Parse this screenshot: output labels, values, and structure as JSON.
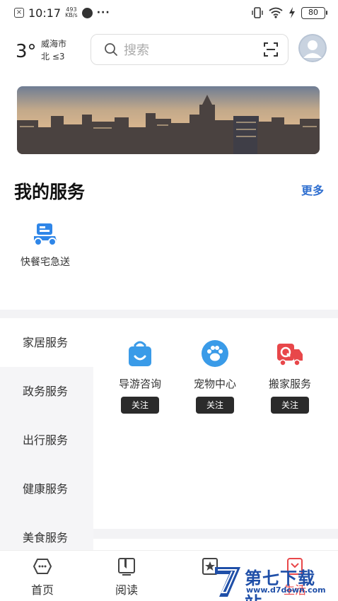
{
  "status_bar": {
    "time": "10:17",
    "net_speed_value": "493",
    "net_speed_unit": "KB/s",
    "more": "···",
    "battery": "80"
  },
  "header": {
    "temperature": "3°",
    "city": "威海市",
    "wind": "北 ≤3",
    "search_placeholder": "搜索"
  },
  "my_services": {
    "title": "我的服务",
    "more": "更多",
    "items": [
      {
        "label": "快餐宅急送",
        "icon": "scooter-icon",
        "color": "#2f86e8"
      }
    ]
  },
  "categories": {
    "items": [
      {
        "label": "家居服务",
        "active": true
      },
      {
        "label": "政务服务",
        "active": false
      },
      {
        "label": "出行服务",
        "active": false
      },
      {
        "label": "健康服务",
        "active": false
      },
      {
        "label": "美食服务",
        "active": false
      }
    ],
    "tiles": [
      {
        "name": "导游咨询",
        "button": "关注",
        "icon": "shopping-bag-icon",
        "color": "#3a9be8"
      },
      {
        "name": "宠物中心",
        "button": "关注",
        "icon": "paw-icon",
        "color": "#3a9be8"
      },
      {
        "name": "搬家服务",
        "button": "关注",
        "icon": "truck-icon",
        "color": "#e8474a"
      }
    ]
  },
  "bottom_nav": {
    "items": [
      {
        "label": "首页",
        "icon": "home-icon"
      },
      {
        "label": "阅读",
        "icon": "book-icon"
      },
      {
        "label": "",
        "icon": "star-icon"
      },
      {
        "label": "生活",
        "icon": "life-icon"
      }
    ]
  },
  "watermark": {
    "text": "第七下载站",
    "url": "www.d7down.com"
  }
}
